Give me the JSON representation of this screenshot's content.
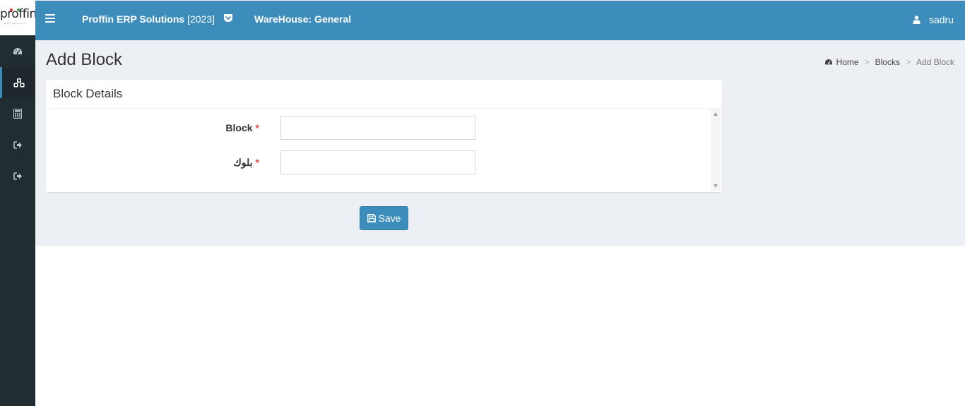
{
  "brand": {
    "logo_text": "proffin",
    "logo_sub": "ERP Solutions",
    "dot_colors": [
      "#e53935",
      "#43a047"
    ]
  },
  "sidebar": {
    "items": [
      {
        "icon": "dashboard-icon",
        "active": false
      },
      {
        "icon": "cubes-icon",
        "active": true
      },
      {
        "icon": "calculator-icon",
        "active": false
      },
      {
        "icon": "sign-out-icon",
        "active": false
      },
      {
        "icon": "sign-out-icon",
        "active": false
      }
    ]
  },
  "topbar": {
    "app_title": "Proffin ERP Solutions",
    "app_year": "[2023]",
    "warehouse": "WareHouse: General",
    "username": "sadru"
  },
  "page": {
    "title": "Add Block",
    "breadcrumb": {
      "home": "Home",
      "sep1": ">",
      "blocks": "Blocks",
      "sep2": ">",
      "current": "Add Block"
    }
  },
  "form": {
    "box_title": "Block Details",
    "block_label": "Block",
    "block_arabic_label": "بلوك",
    "required_mark": "*",
    "block_value": "",
    "block_arabic_value": "",
    "save_label": "Save"
  },
  "colors": {
    "topbar": "#3c8dbc",
    "sidebar": "#222d32",
    "content_bg": "#ecf0f5",
    "required": "#dd4b39"
  }
}
